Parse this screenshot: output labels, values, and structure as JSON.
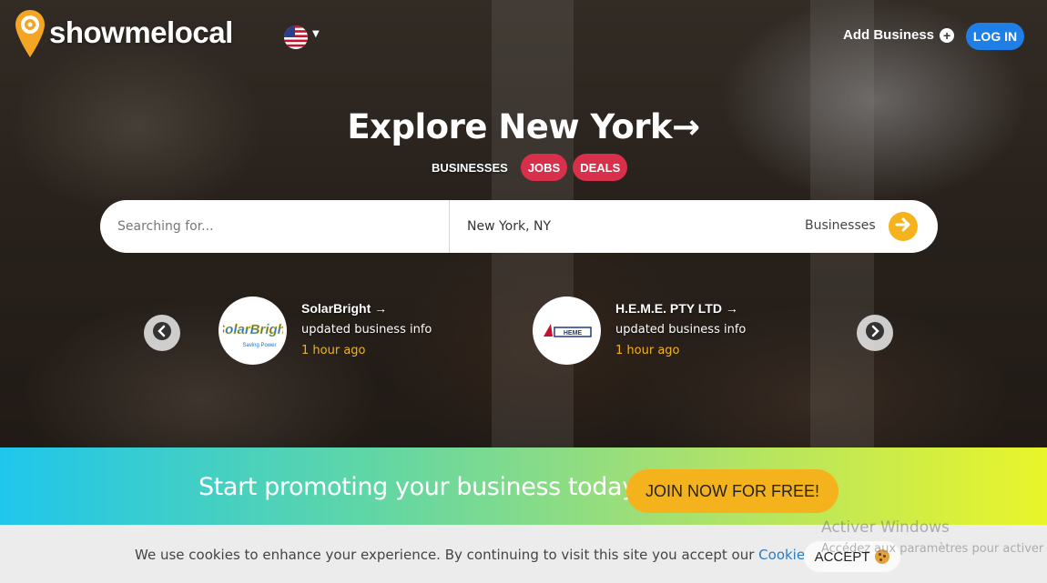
{
  "header": {
    "logo_text": "showmelocal",
    "country_flag": "us-flag-icon",
    "add_business_label": "Add Business",
    "login_label": "LOG IN"
  },
  "hero": {
    "title": "Explore New York→",
    "tabs": [
      {
        "label": "BUSINESSES"
      },
      {
        "label": "JOBS"
      },
      {
        "label": "DEALS"
      }
    ]
  },
  "search": {
    "query_placeholder": "Searching for...",
    "location_value": "New York, NY",
    "category_value": "Businesses"
  },
  "activity": [
    {
      "name": "SolarBright →",
      "action": "updated business info",
      "time": "1 hour ago",
      "logo_text": "SolarBright",
      "logo_subtext": "Saving Power"
    },
    {
      "name": "H.E.M.E. PTY LTD →",
      "action": "updated business info",
      "time": "1 hour ago",
      "logo_text": "HEME"
    }
  ],
  "promo": {
    "text": "Start promoting your business today",
    "button_label": "JOIN NOW FOR FREE!"
  },
  "cookie": {
    "text": "We use cookies to enhance your experience. By continuing to visit this site you accept our",
    "link_text": "Cookie Policy",
    "accept_label": "ACCEPT"
  },
  "windows_watermark": {
    "title": "Activer Windows",
    "subtitle": "Accédez aux paramètres pour activer"
  },
  "colors": {
    "brand_orange": "#f5a524",
    "accent_red": "#d8304a",
    "login_blue": "#1e7fe6",
    "cta_yellow": "#f4b31c",
    "link_blue": "#2b7cc4"
  }
}
